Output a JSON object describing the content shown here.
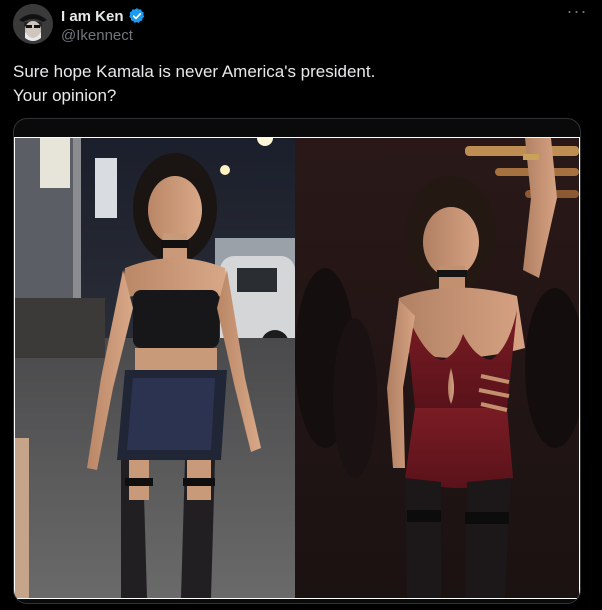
{
  "author": {
    "display_name": "I am Ken",
    "handle": "@Ikennect",
    "verified_icon": "verified-badge-icon",
    "avatar_icon": "avatar-image"
  },
  "more_menu": {
    "label": "···",
    "icon": "more-horizontal-icon"
  },
  "tweet": {
    "text": "Sure hope Kamala is never America's president.\nYour opinion?"
  },
  "media": {
    "type": "photo",
    "panels": [
      "left-photo",
      "right-photo"
    ]
  },
  "colors": {
    "background": "#000000",
    "text": "#e7e9ea",
    "secondary": "#71767b",
    "verified": "#1d9bf0",
    "border": "#2f3336"
  }
}
